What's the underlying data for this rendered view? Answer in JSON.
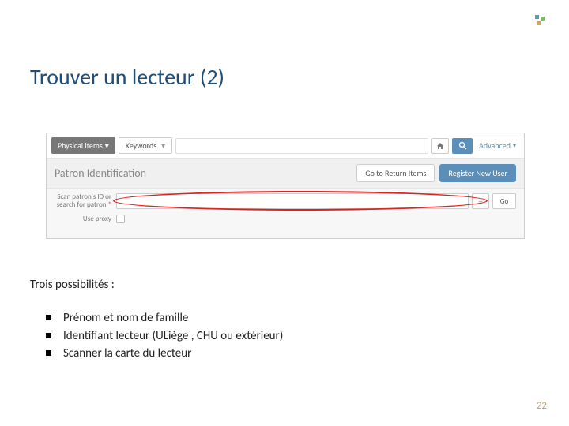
{
  "title": "Trouver un lecteur (2)",
  "toolbar": {
    "scope": "Physical items",
    "keywords": "Keywords",
    "advanced": "Advanced"
  },
  "section": {
    "heading": "Patron Identification",
    "returnBtn": "Go to Return Items",
    "registerBtn": "Register New User"
  },
  "form": {
    "scanLabel": "Scan patron's ID or search for patron",
    "goBtn": "Go",
    "proxy": "Use proxy"
  },
  "annot": {
    "ellipse": true
  },
  "intro": "Trois possibilités :",
  "bullets": [
    "Prénom et nom de famille",
    "Identifiant lecteur (ULiège , CHU ou extérieur)",
    "Scanner la carte du lecteur"
  ],
  "pageNumber": "22"
}
